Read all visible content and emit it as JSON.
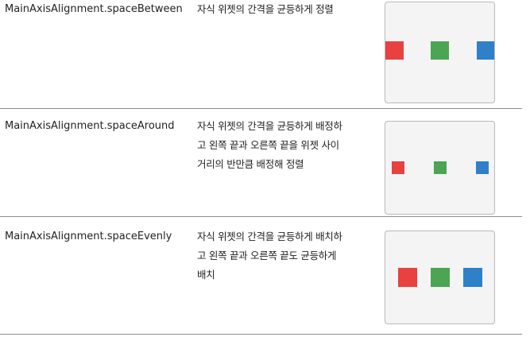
{
  "colors": {
    "red": "#e8413f",
    "green": "#4ba552",
    "blue": "#2f80c9"
  },
  "rows": [
    {
      "name": "MainAxisAlignment.spaceBetween",
      "description_lines": [
        "자식 위젯의 간격을 균등하게 정렬"
      ],
      "preview_boxes": [
        "red",
        "green",
        "blue"
      ]
    },
    {
      "name": "MainAxisAlignment.spaceAround",
      "description_lines": [
        "자식 위젯의 간격을 균등하게 배정하",
        "고 왼쪽 끝과 오른쪽 끝을 위젯 사이",
        "거리의 반만큼 배정해 정렬"
      ],
      "preview_boxes": [
        "red",
        "green",
        "blue"
      ]
    },
    {
      "name": "MainAxisAlignment.spaceEvenly",
      "description_lines": [
        "자식 위젯의 간격을 균등하게 배치하",
        "고 왼쪽 끝과 오른쪽 끝도 균등하게",
        "배치"
      ],
      "preview_boxes": [
        "red",
        "green",
        "blue"
      ]
    }
  ]
}
